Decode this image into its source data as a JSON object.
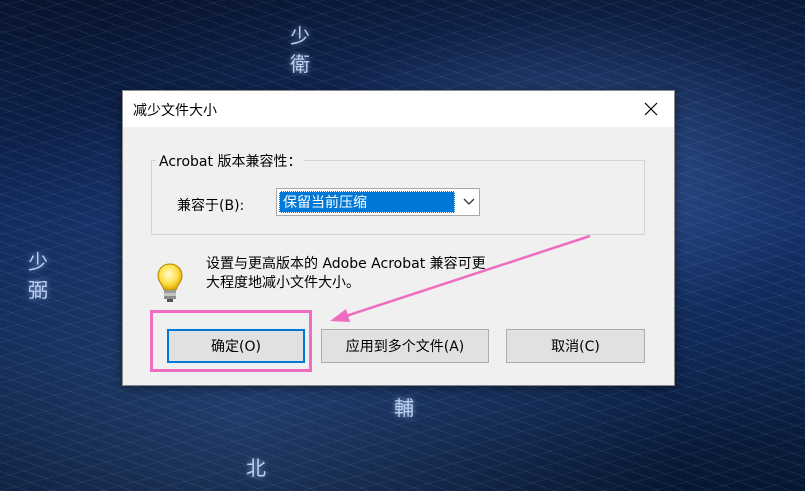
{
  "background": {
    "decor_chars": [
      "少",
      "衛",
      "少",
      "弼",
      "輔",
      "北"
    ]
  },
  "dialog": {
    "title": "减少文件大小",
    "close_icon": "close-icon",
    "group_label": "Acrobat 版本兼容性：",
    "compat_label": "兼容于(B):",
    "compat_selected": "保留当前压缩",
    "tip_icon": "lightbulb-icon",
    "tip_text_line1": "设置与更高版本的 Adobe Acrobat 兼容可更",
    "tip_text_line2": "大程度地减小文件大小。",
    "buttons": {
      "ok": "确定(O)",
      "apply_multiple": "应用到多个文件(A)",
      "cancel": "取消(C)"
    }
  },
  "annotation": {
    "highlight_color": "#f06cc0",
    "arrow_color": "#f06cc0"
  }
}
